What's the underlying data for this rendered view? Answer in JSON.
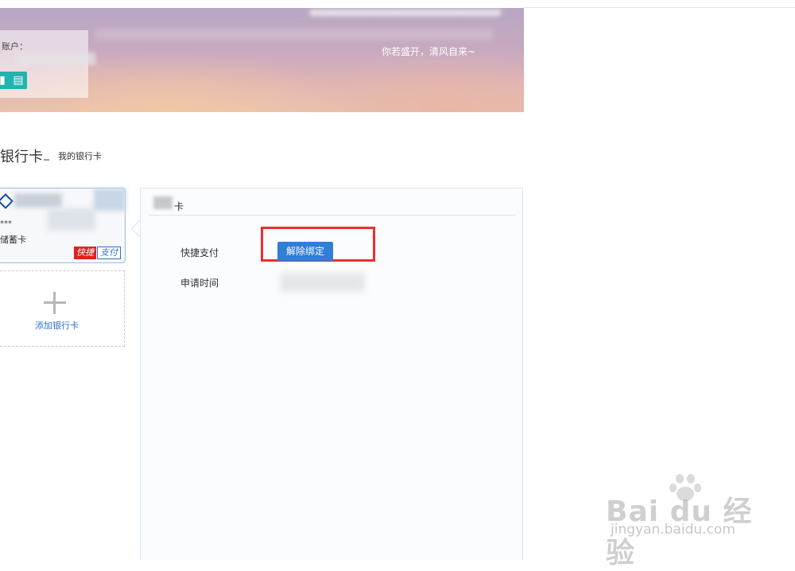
{
  "banner": {
    "account_label": "账户：",
    "badge_icons": [
      "user-badge-icon",
      "card-badge-icon"
    ],
    "motto": "你若盛开，清风自来~"
  },
  "page": {
    "title": "银行卡",
    "separator": "_",
    "subtitle": "我的银行卡"
  },
  "cards": [
    {
      "masked_number": "***",
      "type": "储蓄卡",
      "tag_quick": "快捷",
      "tag_pay": "支付"
    }
  ],
  "add_card": {
    "label": "添加银行卡"
  },
  "detail": {
    "title": "卡",
    "quick_pay_label": "快捷支付",
    "unbind_label": "解除绑定",
    "apply_time_label": "申请时间"
  },
  "watermark": {
    "main": "Bai du 经验",
    "sub": "jingyan.baidu.com"
  },
  "colors": {
    "accent_blue": "#2f7ed8",
    "highlight_red": "#ee2e2e",
    "badge_teal": "#1fb4b0",
    "tag_red": "#e02020"
  }
}
